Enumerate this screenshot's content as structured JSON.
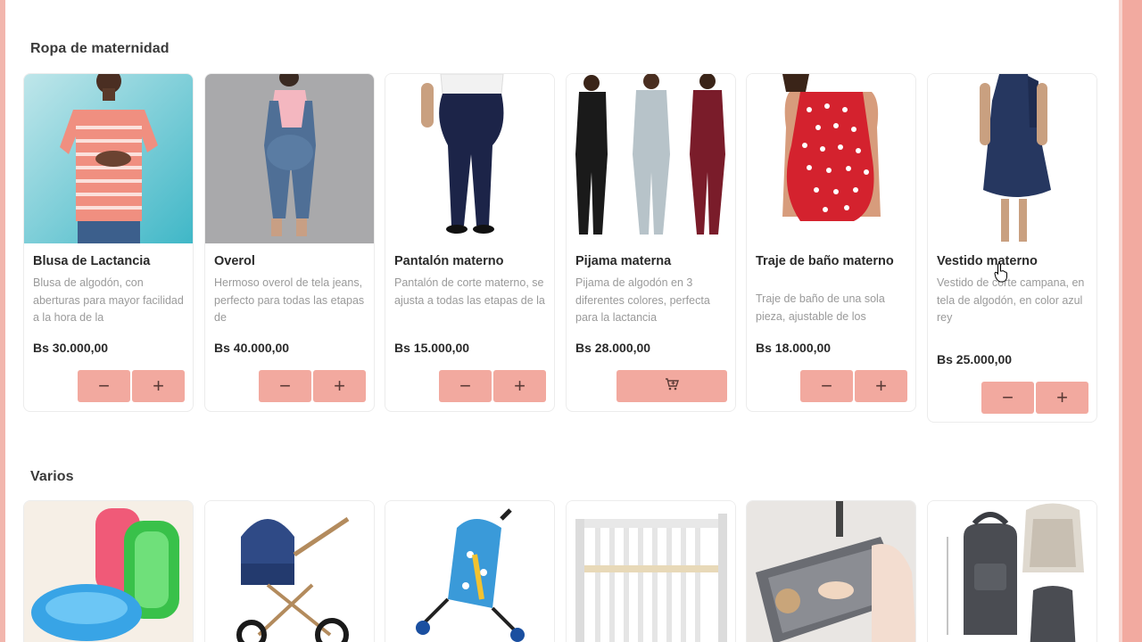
{
  "sections": {
    "ropa": {
      "title": "Ropa de maternidad",
      "products": [
        {
          "name": "Blusa de Lactancia",
          "description": "Blusa de algodón, con aberturas para mayor facilidad a la hora de la",
          "price": "Bs 30.000,00",
          "action": "qty"
        },
        {
          "name": "Overol",
          "description": "Hermoso overol de tela jeans, perfecto para todas las etapas de",
          "price": "Bs 40.000,00",
          "action": "qty"
        },
        {
          "name": "Pantalón materno",
          "description": "Pantalón de corte materno, se ajusta a todas las etapas de la",
          "price": "Bs 15.000,00",
          "action": "qty"
        },
        {
          "name": "Pijama materna",
          "description": "Pijama de algodón en 3 diferentes colores, perfecta para la lactancia",
          "price": "Bs 28.000,00",
          "action": "cart"
        },
        {
          "name": "Traje de baño materno",
          "description": "Traje de baño de una sola pieza, ajustable de los",
          "price": "Bs 18.000,00",
          "action": "qty"
        },
        {
          "name": "Vestido materno",
          "description": "Vestido de corte campana, en tela de algodón, en color azul rey",
          "price": "Bs 25.000,00",
          "action": "qty"
        }
      ]
    },
    "varios": {
      "title": "Varios",
      "products": [
        {
          "image": "baby-bathtubs-icon"
        },
        {
          "image": "baby-pram-icon"
        },
        {
          "image": "baby-stroller-icon"
        },
        {
          "image": "baby-crib-icon"
        },
        {
          "image": "playard-crib-icon"
        },
        {
          "image": "diaper-backpack-icon"
        }
      ]
    }
  },
  "controls": {
    "minus": "−",
    "plus": "+",
    "cart_icon": "cart-add-icon"
  },
  "colors": {
    "accent": "#f2a99f",
    "edge": "#f2b6ad"
  }
}
